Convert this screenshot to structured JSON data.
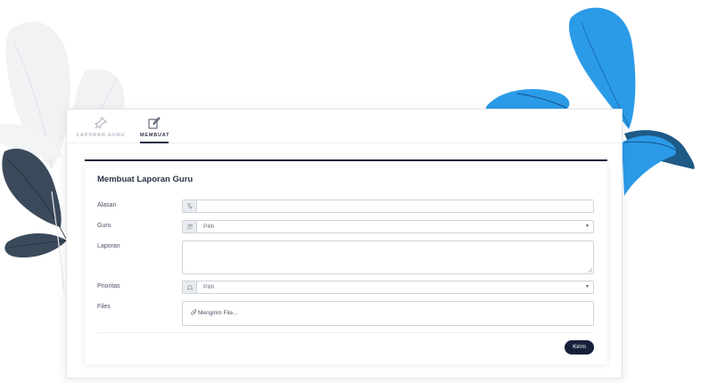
{
  "tabs": [
    {
      "label": "LAPORAN GURU",
      "icon": "pin-icon",
      "active": false
    },
    {
      "label": "MEMBUAT",
      "icon": "edit-icon",
      "active": true
    }
  ],
  "form": {
    "title": "Membuat Laporan Guru",
    "fields": {
      "alasan": {
        "label": "Alasan",
        "value": "",
        "icon": "text-format-icon"
      },
      "guru": {
        "label": "Guru",
        "selected": "Pilih",
        "icon": "users-icon"
      },
      "laporan": {
        "label": "Laporan",
        "value": ""
      },
      "prioritas": {
        "label": "Prioritas",
        "selected": "Pilih",
        "icon": "bell-icon"
      },
      "files": {
        "label": "Files",
        "button_text": "Mengirim File...",
        "icon": "paperclip-icon"
      }
    },
    "submit_label": "Kirim"
  },
  "colors": {
    "accent": "#16203b",
    "decor_blue": "#2b9be8",
    "decor_dark_blue": "#1d5a86",
    "decor_slate": "#3b4a5a",
    "decor_grey": "#eef0f2"
  }
}
